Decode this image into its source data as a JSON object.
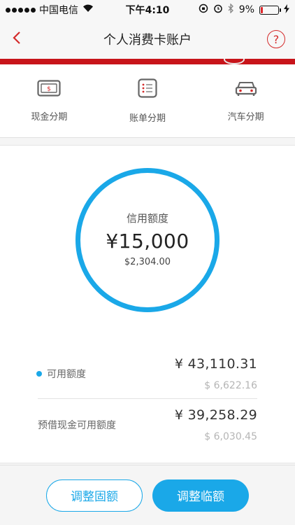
{
  "status_bar": {
    "carrier": "中国电信",
    "time": "下午4:10",
    "battery_percent": "9%",
    "battery_level": 0.09,
    "signal_icon": "signal-dots-icon",
    "wifi_icon": "wifi-icon",
    "lock_icon": "orientation-lock-icon",
    "alarm_icon": "alarm-icon",
    "bluetooth_icon": "bluetooth-icon",
    "charging_icon": "charging-bolt-icon"
  },
  "nav": {
    "title": "个人消费卡账户",
    "back_icon": "chevron-left-icon",
    "help_label": "?",
    "accent_color": "#d42b2b"
  },
  "features": [
    {
      "label": "现金分期",
      "icon": "cash-card-icon"
    },
    {
      "label": "账单分期",
      "icon": "bill-list-icon"
    },
    {
      "label": "汽车分期",
      "icon": "car-icon"
    }
  ],
  "credit": {
    "label": "信用额度",
    "amount": "¥15,000",
    "usd_amount": "$2,304.00",
    "ring_color": "#1aa8e8"
  },
  "limits": [
    {
      "label": "可用额度",
      "cny": "¥ 43,110.31",
      "usd": "$ 6,622.16"
    },
    {
      "label": "预借现金可用额度",
      "cny": "¥ 39,258.29",
      "usd": "$ 6,030.45"
    }
  ],
  "actions": {
    "adjust_fixed": "调整固额",
    "adjust_temp": "调整临额"
  }
}
